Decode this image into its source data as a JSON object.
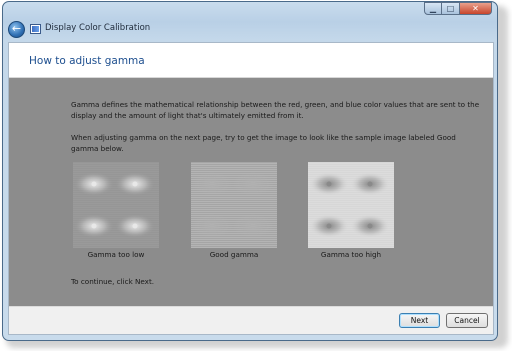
{
  "window": {
    "title": "Display Color Calibration",
    "caption_buttons": {
      "minimize": "▁",
      "maximize": "□",
      "close": "✕"
    }
  },
  "page": {
    "heading": "How to adjust gamma",
    "paragraph1": "Gamma defines the mathematical relationship between the red, green, and blue color values that are sent to the display and the amount of light that's ultimately emitted from it.",
    "paragraph2": "When adjusting gamma on the next page, try to get the image to look like the sample image labeled Good gamma below.",
    "continue_text": "To continue, click Next."
  },
  "samples": [
    {
      "label": "Gamma too low",
      "background": "#9a9a9a",
      "dot": "#e8e8e8"
    },
    {
      "label": "Good gamma",
      "background": "#b4b4b4",
      "dot": "#b0b0b0"
    },
    {
      "label": "Gamma too high",
      "background": "#dcdcdc",
      "dot": "#8a8a8a"
    }
  ],
  "footer": {
    "next_label": "Next",
    "cancel_label": "Cancel"
  }
}
